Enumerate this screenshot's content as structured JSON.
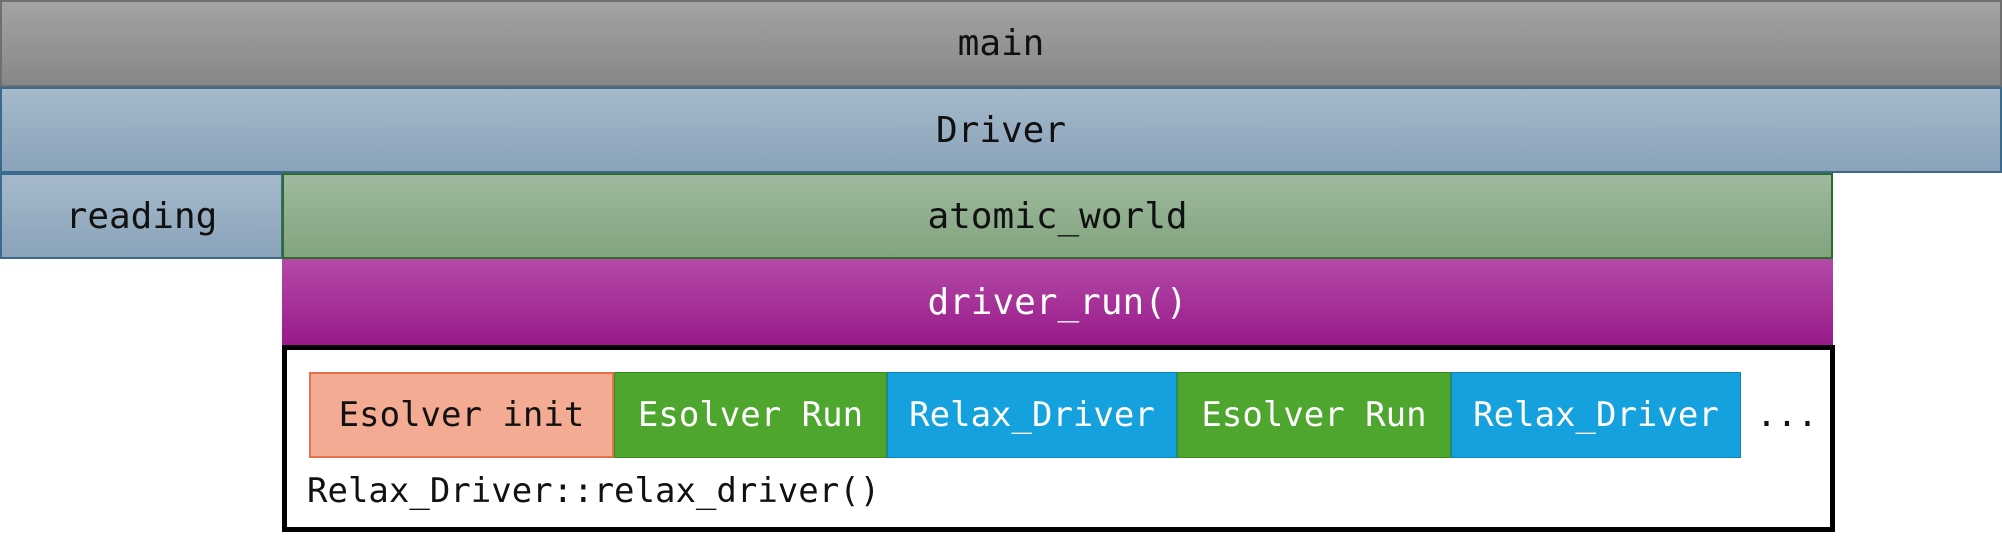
{
  "layers": {
    "main": "main",
    "driver": "Driver",
    "reading": "reading",
    "atomic_world": "atomic_world",
    "driver_run": "driver_run()"
  },
  "relax_driver": {
    "caption": "Relax_Driver::relax_driver()",
    "steps": [
      {
        "label": "Esolver init",
        "color": "#f4ab94"
      },
      {
        "label": "Esolver Run",
        "color": "#4ea62f"
      },
      {
        "label": "Relax_Driver",
        "color": "#14a1dd"
      },
      {
        "label": "Esolver Run",
        "color": "#4ea62f"
      },
      {
        "label": "Relax_Driver",
        "color": "#14a1dd"
      }
    ],
    "continuation": "..."
  }
}
